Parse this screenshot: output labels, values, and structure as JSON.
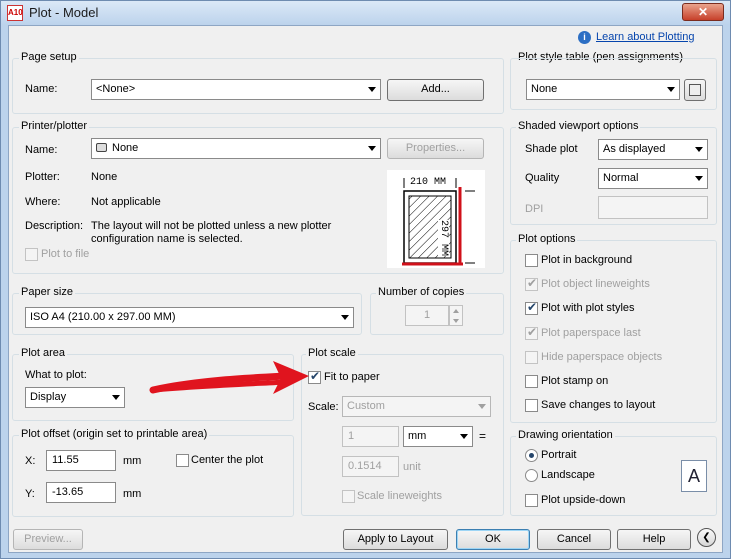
{
  "window": {
    "title": "Plot - Model",
    "close_glyph": "✕",
    "app_icon_text": "A10"
  },
  "help_link": "Learn about Plotting",
  "page_setup": {
    "label": "Page setup",
    "name_label": "Name:",
    "name_value": "<None>",
    "add_button": "Add..."
  },
  "printer": {
    "label": "Printer/plotter",
    "name_label": "Name:",
    "name_value": "None",
    "properties_button": "Properties...",
    "plotter_label": "Plotter:",
    "plotter_value": "None",
    "where_label": "Where:",
    "where_value": "Not applicable",
    "description_label": "Description:",
    "description_line1": "The layout will not be plotted unless a new plotter",
    "description_line2": "configuration name is selected.",
    "plot_to_file": "Plot to file",
    "preview_width": "210  MM",
    "preview_height": "297  MM"
  },
  "paper_size": {
    "label": "Paper size",
    "value": "ISO A4 (210.00 x 297.00 MM)"
  },
  "copies": {
    "label": "Number of copies",
    "value": "1"
  },
  "plot_area": {
    "label": "Plot area",
    "what_label": "What to plot:",
    "what_value": "Display"
  },
  "plot_offset": {
    "label": "Plot offset (origin set to printable area)",
    "x_label": "X:",
    "x_value": "11.55",
    "x_unit": "mm",
    "y_label": "Y:",
    "y_value": "-13.65",
    "y_unit": "mm",
    "center": "Center the plot"
  },
  "plot_scale": {
    "label": "Plot scale",
    "fit_to_paper": "Fit to paper",
    "scale_label": "Scale:",
    "scale_value": "Custom",
    "value1": "1",
    "unit1": "mm",
    "equals": "=",
    "value2": "0.1514",
    "unit2": "unit",
    "scale_lineweights": "Scale lineweights"
  },
  "plot_style_table": {
    "label": "Plot style table (pen assignments)",
    "value": "None"
  },
  "shaded_viewport": {
    "label": "Shaded viewport options",
    "shade_label": "Shade plot",
    "shade_value": "As displayed",
    "quality_label": "Quality",
    "quality_value": "Normal",
    "dpi_label": "DPI"
  },
  "plot_options": {
    "label": "Plot options",
    "items": [
      {
        "text": "Plot in background",
        "checked": false,
        "enabled": true
      },
      {
        "text": "Plot object lineweights",
        "checked": true,
        "enabled": false
      },
      {
        "text": "Plot with plot styles",
        "checked": true,
        "enabled": true
      },
      {
        "text": "Plot paperspace last",
        "checked": true,
        "enabled": false
      },
      {
        "text": "Hide paperspace objects",
        "checked": false,
        "enabled": false
      },
      {
        "text": "Plot stamp on",
        "checked": false,
        "enabled": true
      },
      {
        "text": "Save changes to layout",
        "checked": false,
        "enabled": true
      }
    ]
  },
  "orientation": {
    "label": "Drawing orientation",
    "portrait": "Portrait",
    "landscape": "Landscape",
    "upside_down": "Plot upside-down",
    "icon_letter": "A"
  },
  "buttons": {
    "preview": "Preview...",
    "apply": "Apply to Layout",
    "ok": "OK",
    "cancel": "Cancel",
    "help": "Help",
    "expand_glyph": "❮"
  },
  "colors": {
    "annotation_arrow": "#e0141e",
    "preview_frame": "#d0101a"
  }
}
